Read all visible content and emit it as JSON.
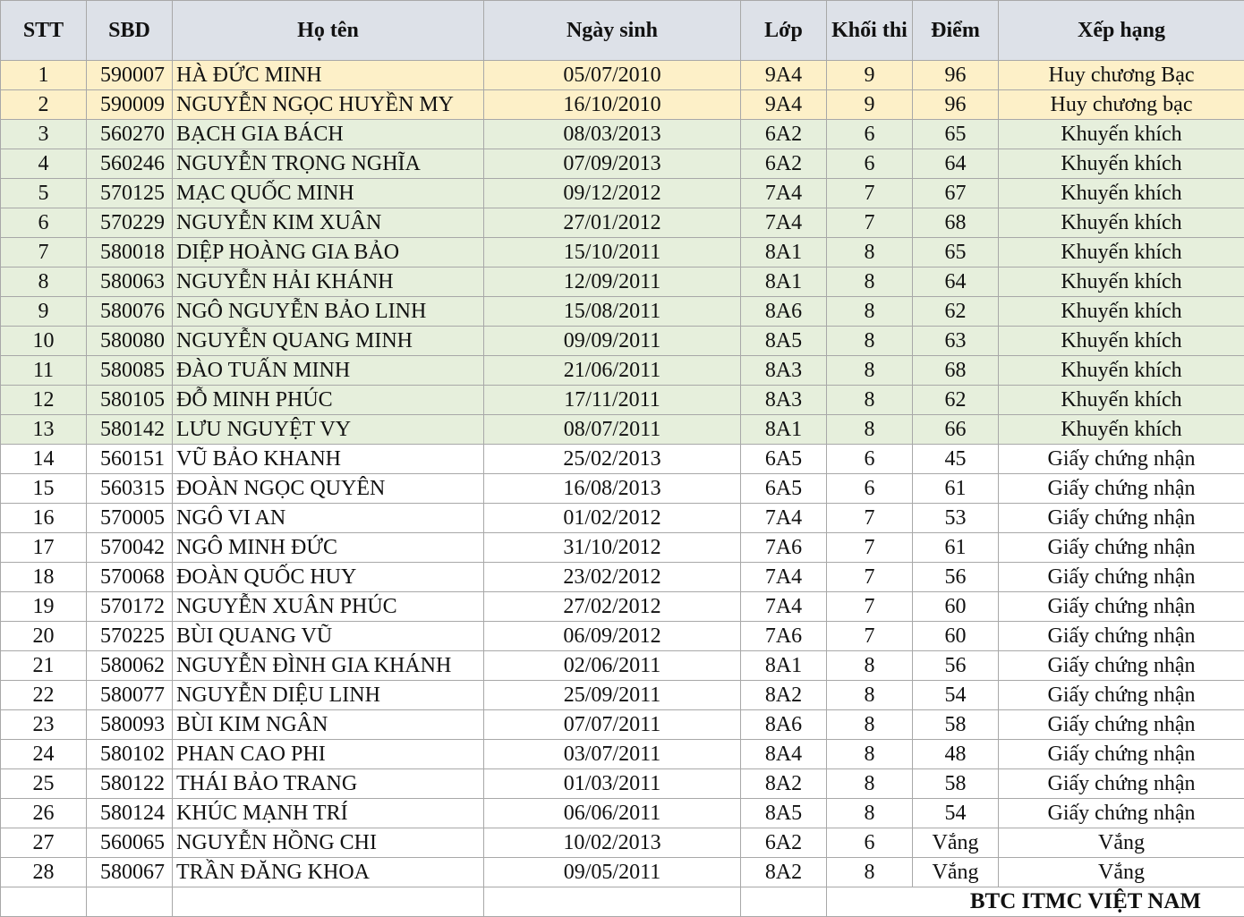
{
  "headers": {
    "stt": "STT",
    "sbd": "SBD",
    "name": "Họ tên",
    "dob": "Ngày sinh",
    "class": "Lớp",
    "grade": "Khối thi",
    "score": "Điểm",
    "rank": "Xếp hạng"
  },
  "colors": {
    "header_bg": "#dde1e8",
    "gold_row": "#fdf0c8",
    "green_row": "#e6efdc",
    "border": "#a8a8a8"
  },
  "rows": [
    {
      "stt": "1",
      "sbd": "590007",
      "name": "HÀ ĐỨC MINH",
      "dob": "05/07/2010",
      "class": "9A4",
      "grade": "9",
      "score": "96",
      "rank": "Huy chương Bạc",
      "tier": "gold"
    },
    {
      "stt": "2",
      "sbd": "590009",
      "name": "NGUYỄN NGỌC HUYỀN MY",
      "dob": "16/10/2010",
      "class": "9A4",
      "grade": "9",
      "score": "96",
      "rank": "Huy chương bạc",
      "tier": "gold"
    },
    {
      "stt": "3",
      "sbd": "560270",
      "name": "BẠCH GIA BÁCH",
      "dob": "08/03/2013",
      "class": "6A2",
      "grade": "6",
      "score": "65",
      "rank": "Khuyến khích",
      "tier": "green"
    },
    {
      "stt": "4",
      "sbd": "560246",
      "name": "NGUYỄN TRỌNG NGHĨA",
      "dob": "07/09/2013",
      "class": "6A2",
      "grade": "6",
      "score": "64",
      "rank": "Khuyến khích",
      "tier": "green"
    },
    {
      "stt": "5",
      "sbd": "570125",
      "name": "MẠC QUỐC MINH",
      "dob": "09/12/2012",
      "class": "7A4",
      "grade": "7",
      "score": "67",
      "rank": "Khuyến khích",
      "tier": "green"
    },
    {
      "stt": "6",
      "sbd": "570229",
      "name": "NGUYỄN KIM XUÂN",
      "dob": "27/01/2012",
      "class": "7A4",
      "grade": "7",
      "score": "68",
      "rank": "Khuyến khích",
      "tier": "green"
    },
    {
      "stt": "7",
      "sbd": "580018",
      "name": "DIỆP HOÀNG GIA BẢO",
      "dob": "15/10/2011",
      "class": "8A1",
      "grade": "8",
      "score": "65",
      "rank": "Khuyến khích",
      "tier": "green"
    },
    {
      "stt": "8",
      "sbd": "580063",
      "name": "NGUYỄN HẢI KHÁNH",
      "dob": "12/09/2011",
      "class": "8A1",
      "grade": "8",
      "score": "64",
      "rank": "Khuyến khích",
      "tier": "green"
    },
    {
      "stt": "9",
      "sbd": "580076",
      "name": "NGÔ NGUYỄN BẢO LINH",
      "dob": "15/08/2011",
      "class": "8A6",
      "grade": "8",
      "score": "62",
      "rank": "Khuyến khích",
      "tier": "green"
    },
    {
      "stt": "10",
      "sbd": "580080",
      "name": "NGUYỄN QUANG MINH",
      "dob": "09/09/2011",
      "class": "8A5",
      "grade": "8",
      "score": "63",
      "rank": "Khuyến khích",
      "tier": "green"
    },
    {
      "stt": "11",
      "sbd": "580085",
      "name": "ĐÀO TUẤN MINH",
      "dob": "21/06/2011",
      "class": "8A3",
      "grade": "8",
      "score": "68",
      "rank": "Khuyến khích",
      "tier": "green"
    },
    {
      "stt": "12",
      "sbd": "580105",
      "name": "ĐỖ MINH PHÚC",
      "dob": "17/11/2011",
      "class": "8A3",
      "grade": "8",
      "score": "62",
      "rank": "Khuyến khích",
      "tier": "green"
    },
    {
      "stt": "13",
      "sbd": "580142",
      "name": "LƯU NGUYỆT VY",
      "dob": "08/07/2011",
      "class": "8A1",
      "grade": "8",
      "score": "66",
      "rank": "Khuyến khích",
      "tier": "green"
    },
    {
      "stt": "14",
      "sbd": "560151",
      "name": "VŨ BẢO KHANH",
      "dob": "25/02/2013",
      "class": "6A5",
      "grade": "6",
      "score": "45",
      "rank": "Giấy chứng nhận",
      "tier": "plain"
    },
    {
      "stt": "15",
      "sbd": "560315",
      "name": "ĐOÀN NGỌC QUYÊN",
      "dob": "16/08/2013",
      "class": "6A5",
      "grade": "6",
      "score": "61",
      "rank": "Giấy chứng nhận",
      "tier": "plain"
    },
    {
      "stt": "16",
      "sbd": "570005",
      "name": "NGÔ VI AN",
      "dob": "01/02/2012",
      "class": "7A4",
      "grade": "7",
      "score": "53",
      "rank": "Giấy chứng nhận",
      "tier": "plain"
    },
    {
      "stt": "17",
      "sbd": "570042",
      "name": "NGÔ MINH ĐỨC",
      "dob": "31/10/2012",
      "class": "7A6",
      "grade": "7",
      "score": "61",
      "rank": "Giấy chứng nhận",
      "tier": "plain"
    },
    {
      "stt": "18",
      "sbd": "570068",
      "name": "ĐOÀN QUỐC HUY",
      "dob": "23/02/2012",
      "class": "7A4",
      "grade": "7",
      "score": "56",
      "rank": "Giấy chứng nhận",
      "tier": "plain"
    },
    {
      "stt": "19",
      "sbd": "570172",
      "name": "NGUYỄN XUÂN PHÚC",
      "dob": "27/02/2012",
      "class": "7A4",
      "grade": "7",
      "score": "60",
      "rank": "Giấy chứng nhận",
      "tier": "plain"
    },
    {
      "stt": "20",
      "sbd": "570225",
      "name": "BÙI QUANG VŨ",
      "dob": "06/09/2012",
      "class": "7A6",
      "grade": "7",
      "score": "60",
      "rank": "Giấy chứng nhận",
      "tier": "plain"
    },
    {
      "stt": "21",
      "sbd": "580062",
      "name": "NGUYỄN ĐÌNH GIA KHÁNH",
      "dob": "02/06/2011",
      "class": "8A1",
      "grade": "8",
      "score": "56",
      "rank": "Giấy chứng nhận",
      "tier": "plain"
    },
    {
      "stt": "22",
      "sbd": "580077",
      "name": "NGUYỄN DIỆU LINH",
      "dob": "25/09/2011",
      "class": "8A2",
      "grade": "8",
      "score": "54",
      "rank": "Giấy chứng nhận",
      "tier": "plain"
    },
    {
      "stt": "23",
      "sbd": "580093",
      "name": "BÙI KIM NGÂN",
      "dob": "07/07/2011",
      "class": "8A6",
      "grade": "8",
      "score": "58",
      "rank": "Giấy chứng nhận",
      "tier": "plain"
    },
    {
      "stt": "24",
      "sbd": "580102",
      "name": "PHAN CAO PHI",
      "dob": "03/07/2011",
      "class": "8A4",
      "grade": "8",
      "score": "48",
      "rank": "Giấy chứng nhận",
      "tier": "plain"
    },
    {
      "stt": "25",
      "sbd": "580122",
      "name": "THÁI BẢO TRANG",
      "dob": "01/03/2011",
      "class": "8A2",
      "grade": "8",
      "score": "58",
      "rank": "Giấy chứng nhận",
      "tier": "plain"
    },
    {
      "stt": "26",
      "sbd": "580124",
      "name": "KHÚC MẠNH TRÍ",
      "dob": "06/06/2011",
      "class": "8A5",
      "grade": "8",
      "score": "54",
      "rank": "Giấy chứng nhận",
      "tier": "plain"
    },
    {
      "stt": "27",
      "sbd": "560065",
      "name": "NGUYỄN HỒNG CHI",
      "dob": "10/02/2013",
      "class": "6A2",
      "grade": "6",
      "score": "Vắng",
      "rank": "Vắng",
      "tier": "plain"
    },
    {
      "stt": "28",
      "sbd": "580067",
      "name": "TRẦN ĐĂNG KHOA",
      "dob": "09/05/2011",
      "class": "8A2",
      "grade": "8",
      "score": "Vắng",
      "rank": "Vắng",
      "tier": "plain"
    }
  ],
  "footer": {
    "signature": "BTC ITMC VIỆT NAM"
  }
}
